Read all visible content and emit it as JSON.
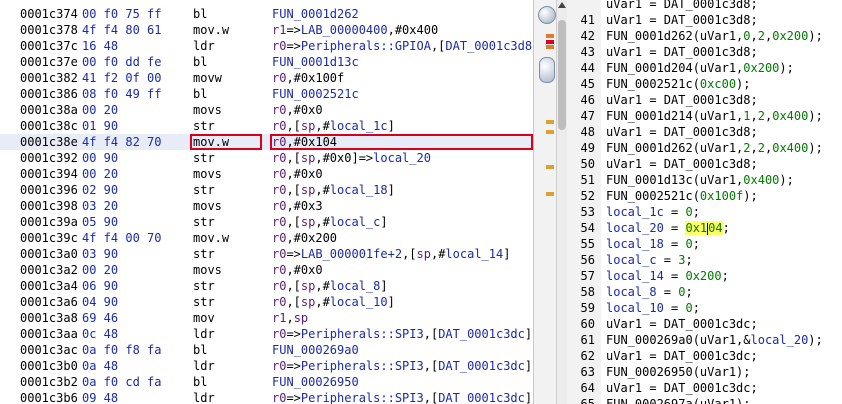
{
  "listing": {
    "rows": [
      {
        "addr": "0001c374",
        "bytes": "00 f0 75 ff",
        "mnem": "bl",
        "ops": "FUN_0001d262"
      },
      {
        "addr": "0001c378",
        "bytes": "4f f4 80 61",
        "mnem": "mov.w",
        "ops": "r1=>LAB_00000400,#0x400"
      },
      {
        "addr": "0001c37c",
        "bytes": "16 48",
        "mnem": "ldr",
        "ops": "r0=>Peripherals::GPIOA,[DAT_0001c3d8]"
      },
      {
        "addr": "0001c37e",
        "bytes": "00 f0 dd fe",
        "mnem": "bl",
        "ops": "FUN_0001d13c"
      },
      {
        "addr": "0001c382",
        "bytes": "41 f2 0f 00",
        "mnem": "movw",
        "ops": "r0,#0x100f"
      },
      {
        "addr": "0001c386",
        "bytes": "08 f0 49 ff",
        "mnem": "bl",
        "ops": "FUN_0002521c"
      },
      {
        "addr": "0001c38a",
        "bytes": "00 20",
        "mnem": "movs",
        "ops": "r0,#0x0"
      },
      {
        "addr": "0001c38c",
        "bytes": "01 90",
        "mnem": "str",
        "ops": "r0,[sp,#local_1c]"
      },
      {
        "addr": "0001c38e",
        "bytes": "4f f4 82 70",
        "mnem": "mov.w",
        "ops": "r0,#0x104"
      },
      {
        "addr": "0001c392",
        "bytes": "00 90",
        "mnem": "str",
        "ops": "r0,[sp,#0x0]=>local_20"
      },
      {
        "addr": "0001c394",
        "bytes": "00 20",
        "mnem": "movs",
        "ops": "r0,#0x0"
      },
      {
        "addr": "0001c396",
        "bytes": "02 90",
        "mnem": "str",
        "ops": "r0,[sp,#local_18]"
      },
      {
        "addr": "0001c398",
        "bytes": "03 20",
        "mnem": "movs",
        "ops": "r0,#0x3"
      },
      {
        "addr": "0001c39a",
        "bytes": "05 90",
        "mnem": "str",
        "ops": "r0,[sp,#local_c]"
      },
      {
        "addr": "0001c39c",
        "bytes": "4f f4 00 70",
        "mnem": "mov.w",
        "ops": "r0,#0x200"
      },
      {
        "addr": "0001c3a0",
        "bytes": "03 90",
        "mnem": "str",
        "ops": "r0=>LAB_000001fe+2,[sp,#local_14]"
      },
      {
        "addr": "0001c3a2",
        "bytes": "00 20",
        "mnem": "movs",
        "ops": "r0,#0x0"
      },
      {
        "addr": "0001c3a4",
        "bytes": "06 90",
        "mnem": "str",
        "ops": "r0,[sp,#local_8]"
      },
      {
        "addr": "0001c3a6",
        "bytes": "04 90",
        "mnem": "str",
        "ops": "r0,[sp,#local_10]"
      },
      {
        "addr": "0001c3a8",
        "bytes": "69 46",
        "mnem": "mov",
        "ops": "r1,sp"
      },
      {
        "addr": "0001c3aa",
        "bytes": "0c 48",
        "mnem": "ldr",
        "ops": "r0=>Peripherals::SPI3,[DAT_0001c3dc]"
      },
      {
        "addr": "0001c3ac",
        "bytes": "0a f0 f8 fa",
        "mnem": "bl",
        "ops": "FUN_000269a0"
      },
      {
        "addr": "0001c3b0",
        "bytes": "0a 48",
        "mnem": "ldr",
        "ops": "r0=>Peripherals::SPI3,[DAT_0001c3dc]"
      },
      {
        "addr": "0001c3b2",
        "bytes": "0a f0 cd fa",
        "mnem": "bl",
        "ops": "FUN_00026950"
      },
      {
        "addr": "0001c3b6",
        "bytes": "09 48",
        "mnem": "ldr",
        "ops": "r0=>Peripherals::SPI3,[DAT_0001c3dc]"
      }
    ],
    "selected_index": 8,
    "highlight_color": "#d9001b"
  },
  "overview_marks": [
    {
      "color": "#e07a2a"
    },
    {
      "color": "#d9001b"
    },
    {
      "color": "#e07a2a"
    },
    {
      "color": "#e0a030"
    },
    {
      "color": "#e0a030"
    },
    {
      "color": "#e0a030"
    },
    {
      "color": "#e0a030"
    }
  ],
  "decompiler": {
    "lines": [
      {
        "n": "41",
        "code": "uVar1 = DAT_0001c3d8;"
      },
      {
        "n": "42",
        "code": "FUN_0001d262(uVar1,0,2,0x200);"
      },
      {
        "n": "43",
        "code": "uVar1 = DAT_0001c3d8;"
      },
      {
        "n": "44",
        "code": "FUN_0001d204(uVar1,0x200);"
      },
      {
        "n": "45",
        "code": "FUN_0002521c(0xc00);"
      },
      {
        "n": "46",
        "code": "uVar1 = DAT_0001c3d8;"
      },
      {
        "n": "47",
        "code": "FUN_0001d214(uVar1,1,2,0x400);"
      },
      {
        "n": "48",
        "code": "uVar1 = DAT_0001c3d8;"
      },
      {
        "n": "49",
        "code": "FUN_0001d262(uVar1,2,2,0x400);"
      },
      {
        "n": "50",
        "code": "uVar1 = DAT_0001c3d8;"
      },
      {
        "n": "51",
        "code": "FUN_0001d13c(uVar1,0x400);"
      },
      {
        "n": "52",
        "code": "FUN_0002521c(0x100f);"
      },
      {
        "n": "53",
        "code": "local_1c = 0;"
      },
      {
        "n": "54",
        "code": "local_20 = 0x104;"
      },
      {
        "n": "55",
        "code": "local_18 = 0;"
      },
      {
        "n": "56",
        "code": "local_c = 3;"
      },
      {
        "n": "57",
        "code": "local_14 = 0x200;"
      },
      {
        "n": "58",
        "code": "local_8 = 0;"
      },
      {
        "n": "59",
        "code": "local_10 = 0;"
      },
      {
        "n": "60",
        "code": "uVar1 = DAT_0001c3dc;"
      },
      {
        "n": "61",
        "code": "FUN_000269a0(uVar1,&local_20);"
      },
      {
        "n": "62",
        "code": "uVar1 = DAT_0001c3dc;"
      },
      {
        "n": "63",
        "code": "FUN_00026950(uVar1);"
      },
      {
        "n": "64",
        "code": "uVar1 = DAT_0001c3dc;"
      },
      {
        "n": "65",
        "code": "FUN_0002697a(uVar1);"
      }
    ],
    "top_partial": "uVar1 = DAT_0001c3d8;"
  }
}
